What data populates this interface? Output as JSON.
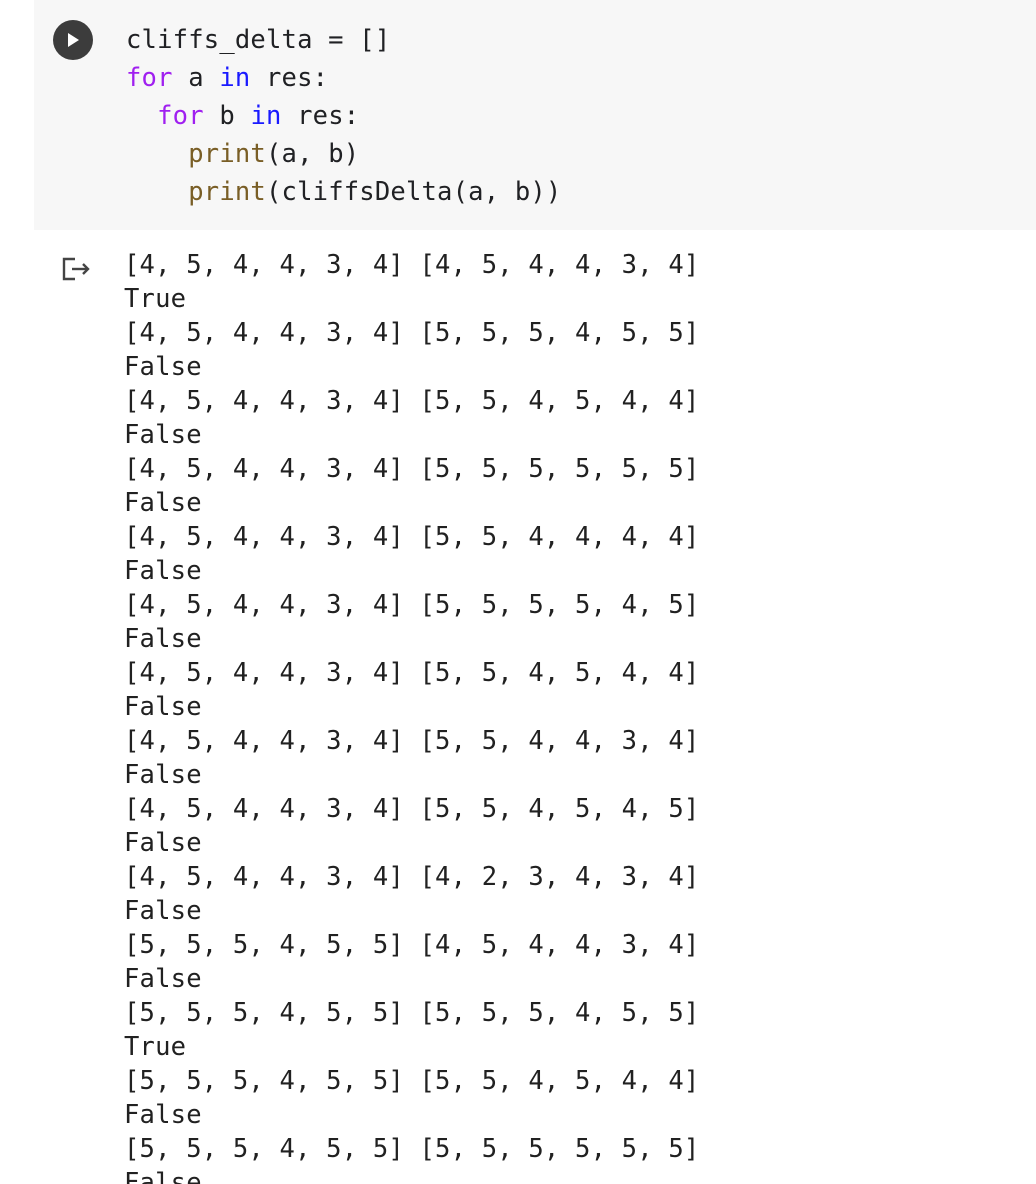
{
  "code_cell": {
    "lines": [
      [
        {
          "t": "cliffs_delta = []",
          "c": ""
        }
      ],
      [
        {
          "t": "for",
          "c": "kw"
        },
        {
          "t": " a ",
          "c": ""
        },
        {
          "t": "in",
          "c": "kw2"
        },
        {
          "t": " res:",
          "c": ""
        }
      ],
      [
        {
          "t": "  ",
          "c": ""
        },
        {
          "t": "for",
          "c": "kw"
        },
        {
          "t": " b ",
          "c": ""
        },
        {
          "t": "in",
          "c": "kw2"
        },
        {
          "t": " res:",
          "c": ""
        }
      ],
      [
        {
          "t": "    ",
          "c": ""
        },
        {
          "t": "print",
          "c": "fn"
        },
        {
          "t": "(a, b)",
          "c": ""
        }
      ],
      [
        {
          "t": "    ",
          "c": ""
        },
        {
          "t": "print",
          "c": "fn"
        },
        {
          "t": "(cliffsDelta(a, b))",
          "c": ""
        }
      ]
    ],
    "run_icon": "play-icon"
  },
  "output_icon": "output-redirect-icon",
  "output_lines": [
    "[4, 5, 4, 4, 3, 4] [4, 5, 4, 4, 3, 4]",
    "True",
    "[4, 5, 4, 4, 3, 4] [5, 5, 5, 4, 5, 5]",
    "False",
    "[4, 5, 4, 4, 3, 4] [5, 5, 4, 5, 4, 4]",
    "False",
    "[4, 5, 4, 4, 3, 4] [5, 5, 5, 5, 5, 5]",
    "False",
    "[4, 5, 4, 4, 3, 4] [5, 5, 4, 4, 4, 4]",
    "False",
    "[4, 5, 4, 4, 3, 4] [5, 5, 5, 5, 4, 5]",
    "False",
    "[4, 5, 4, 4, 3, 4] [5, 5, 4, 5, 4, 4]",
    "False",
    "[4, 5, 4, 4, 3, 4] [5, 5, 4, 4, 3, 4]",
    "False",
    "[4, 5, 4, 4, 3, 4] [5, 5, 4, 5, 4, 5]",
    "False",
    "[4, 5, 4, 4, 3, 4] [4, 2, 3, 4, 3, 4]",
    "False",
    "[5, 5, 5, 4, 5, 5] [4, 5, 4, 4, 3, 4]",
    "False",
    "[5, 5, 5, 4, 5, 5] [5, 5, 5, 4, 5, 5]",
    "True",
    "[5, 5, 5, 4, 5, 5] [5, 5, 4, 5, 4, 4]",
    "False",
    "[5, 5, 5, 4, 5, 5] [5, 5, 5, 5, 5, 5]",
    "False"
  ]
}
